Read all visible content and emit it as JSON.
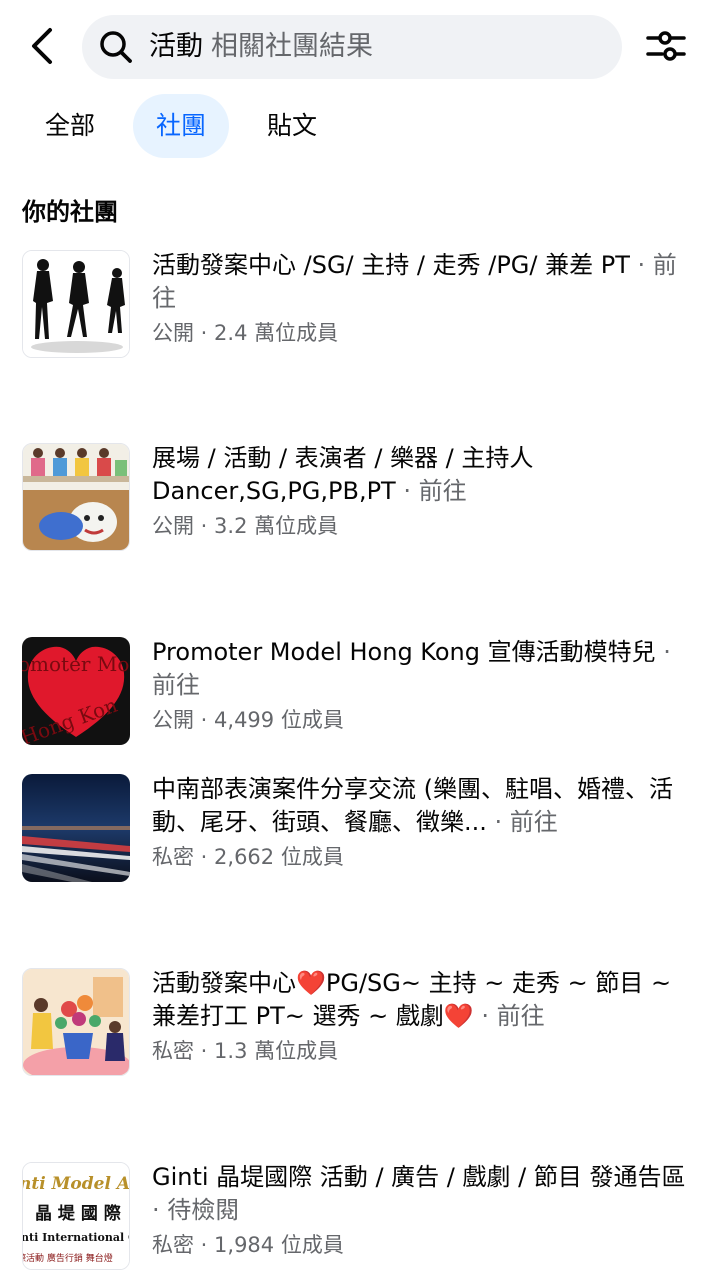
{
  "search": {
    "query": "活動",
    "hint": "相關社團結果"
  },
  "tabs": [
    {
      "label": "全部",
      "active": false
    },
    {
      "label": "社團",
      "active": true
    },
    {
      "label": "貼文",
      "active": false
    }
  ],
  "section_title": "你的社團",
  "groups": [
    {
      "name": "活動發案中心 /SG/ 主持 / 走秀 /PG/ 兼差 PT",
      "action": "前往",
      "privacy": "公開",
      "members": "2.4 萬位成員",
      "thumb_icon": "silhouettes-image"
    },
    {
      "name": "展場 / 活動 / 表演者 / 樂器 / 主持人 Dancer,SG,PG,PB,PT",
      "action": "前往",
      "privacy": "公開",
      "members": "3.2 萬位成員",
      "thumb_icon": "performers-image"
    },
    {
      "name": "Promoter Model Hong Kong 宣傳活動模特兒",
      "action": "前往",
      "privacy": "公開",
      "members": "4,499 位成員",
      "thumb_icon": "heart-logo-image",
      "thumb_text": [
        "omoter Mo",
        "Hong Kon"
      ]
    },
    {
      "name": "中南部表演案件分享交流 (樂團、駐唱、婚禮、活動、尾牙、街頭、餐廳、徵樂...",
      "action": "前往",
      "privacy": "私密",
      "members": "2,662 位成員",
      "thumb_icon": "night-highway-image"
    },
    {
      "name": "活動發案中心❤️PG/SG~ 主持 ~ 走秀 ~ 節目 ~ 兼差打工 PT~ 選秀 ~ 戲劇❤️",
      "action": "前往",
      "privacy": "私密",
      "members": "1.3 萬位成員",
      "thumb_icon": "illustration-image"
    },
    {
      "name": "Ginti 晶堤國際 活動 / 廣告 / 戲劇 / 節目 發通告區",
      "action": "待檢閱",
      "privacy": "私密",
      "members": "1,984 位成員",
      "thumb_icon": "ginti-logo-image",
      "thumb_text": [
        "nti  Model A",
        "晶 堤 國 際",
        "nti International C",
        "際活動  廣告行銷  舞台燈"
      ]
    }
  ],
  "colors": {
    "accent": "#0866ff",
    "accent_bg": "#e7f3ff",
    "secondary_text": "#65676b",
    "search_bg": "#f0f2f5"
  }
}
